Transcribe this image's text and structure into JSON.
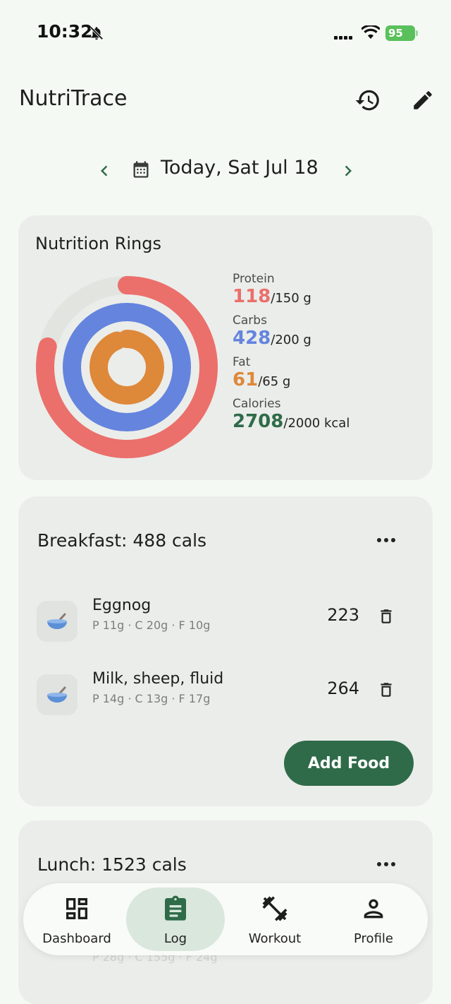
{
  "status_bar": {
    "time": "10:32",
    "battery": "95"
  },
  "app": {
    "title": "NutriTrace"
  },
  "icons": {
    "history": "history-icon",
    "edit": "pencil-icon",
    "calendar": "calendar-icon",
    "prev": "chevron-left-icon",
    "next": "chevron-right-icon",
    "more": "more-horizontal-icon",
    "delete": "trash-icon",
    "food": "bowl-icon"
  },
  "date_nav": {
    "label": "Today, Sat Jul 18"
  },
  "rings": {
    "title": "Nutrition Rings",
    "protein": {
      "label": "Protein",
      "value": "118",
      "goal": "/150 g",
      "color": "#eb6f6b",
      "fraction": 0.79
    },
    "carbs": {
      "label": "Carbs",
      "value": "428",
      "goal": "/200 g",
      "color": "#6484de",
      "fraction": 1.0
    },
    "fat": {
      "label": "Fat",
      "value": "61",
      "goal": "/65 g",
      "color": "#de883a",
      "fraction": 0.94
    },
    "calories": {
      "label": "Calories",
      "value": "2708",
      "goal": "/2000 kcal",
      "color": "#2f6b49"
    }
  },
  "breakfast": {
    "title": "Breakfast: 488 cals",
    "items": [
      {
        "name": "Eggnog",
        "macros": "P 11g · C 20g · F 10g",
        "cals": "223"
      },
      {
        "name": "Milk, sheep, fluid",
        "macros": "P 14g · C 13g · F 17g",
        "cals": "264"
      }
    ],
    "add_label": "Add Food"
  },
  "lunch": {
    "title": "Lunch: 1523 cals",
    "partial_macros": "P 28g · C 155g · F 24g"
  },
  "bottom_nav": {
    "items": [
      {
        "label": "Dashboard",
        "icon": "dashboard-icon"
      },
      {
        "label": "Log",
        "icon": "clipboard-icon",
        "active": true
      },
      {
        "label": "Workout",
        "icon": "dumbbell-icon"
      },
      {
        "label": "Profile",
        "icon": "person-icon"
      }
    ]
  }
}
